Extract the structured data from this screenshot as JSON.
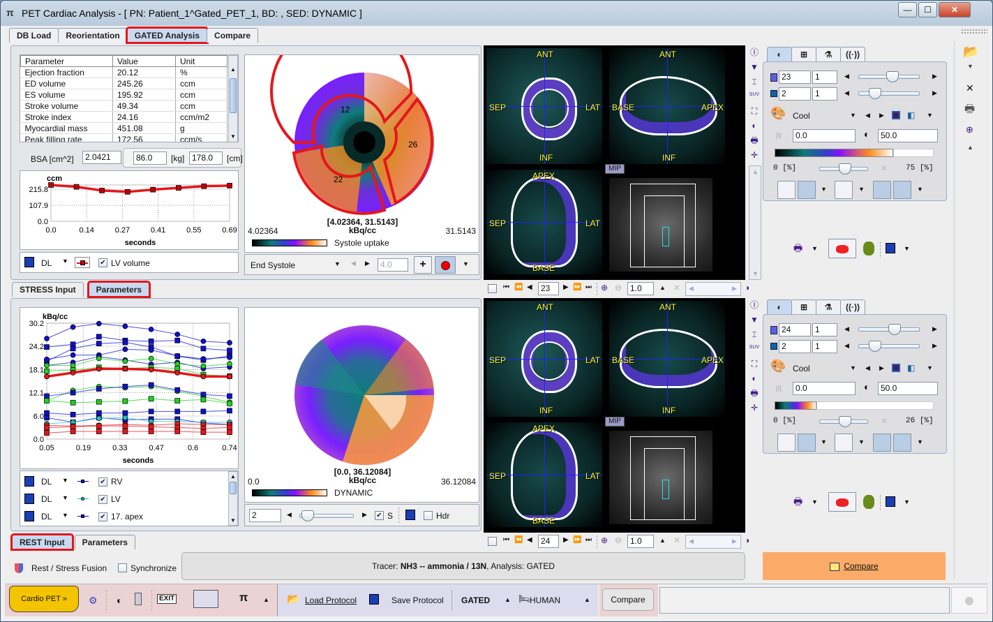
{
  "window": {
    "title": "PET Cardiac Analysis - [ PN: Patient_1^Gated_PET_1, BD: , SED: DYNAMIC ]",
    "app_icon": "pi-icon",
    "buttons": {
      "minimize": "—",
      "maximize": "☐",
      "close": "✕"
    }
  },
  "main_tabs": [
    {
      "label": "DB Load",
      "active": false
    },
    {
      "label": "Reorientation",
      "active": false
    },
    {
      "label": "GATED Analysis",
      "active": true
    },
    {
      "label": "Compare",
      "active": false
    }
  ],
  "stress": {
    "params_table": {
      "headers": [
        "Parameter",
        "Value",
        "Unit"
      ],
      "rows": [
        [
          "Ejection fraction",
          "20.12",
          "%"
        ],
        [
          "ED volume",
          "245.26",
          "ccm"
        ],
        [
          "ES volume",
          "195.92",
          "ccm"
        ],
        [
          "Stroke volume",
          "49.34",
          "ccm"
        ],
        [
          "Stroke index",
          "24.16",
          "ccm/m2"
        ],
        [
          "Myocardial mass",
          "451.08",
          "g"
        ],
        [
          "Peak filling rate",
          "172.56",
          "ccm/s"
        ]
      ]
    },
    "bsa": {
      "label": "BSA [cm^2]",
      "value": "2.0421",
      "weight": "86.0",
      "weight_unit": "[kg]",
      "height": "178.0",
      "height_unit": "[cm]"
    },
    "curve_legend": {
      "save_icon": "save-icon",
      "dl": "DL",
      "series_label": "LV volume",
      "checked": true
    },
    "polar": {
      "range_label": "[4.02364, 31.5143]",
      "unit": "kBq/cc",
      "min": "4.02364",
      "max": "31.5143",
      "colorbar_label": "Systole uptake",
      "segments": [
        "12",
        "26",
        "22"
      ],
      "phase": "End Systole",
      "value_field": "4.0"
    },
    "subtabs": [
      {
        "label": "STRESS Input",
        "active": false
      },
      {
        "label": "Parameters",
        "active": true
      }
    ],
    "viewer": {
      "slice": "23",
      "zoom": "1.0",
      "labels": {
        "ant": "ANT",
        "inf": "INF",
        "sep": "SEP",
        "lat": "LAT",
        "base": "BASE",
        "apex": "APEX",
        "mip": "MIP"
      }
    },
    "control": {
      "frame": "23",
      "frame_step": "1",
      "gate": "2",
      "gate_step": "1",
      "colormap": "Cool",
      "min_value": "0.0",
      "max_value": "50.0",
      "pct_min": "0",
      "pct_max": "75",
      "pct_unit": "[%]",
      "frame_slider": 0.55,
      "gate_slider": 0.2,
      "pct_slider": 0.45
    }
  },
  "rest": {
    "curve_legend": [
      {
        "dl": "DL",
        "label": "RV",
        "checked": true,
        "color": "#1010d0"
      },
      {
        "dl": "DL",
        "label": "LV",
        "checked": true,
        "color": "#20c0c0"
      },
      {
        "dl": "DL",
        "label": "17. apex",
        "checked": true,
        "color": "#1010d0"
      }
    ],
    "polar": {
      "range_label": "[0.0, 36.12084]",
      "unit": "kBq/cc",
      "min": "0.0",
      "max": "36.12084",
      "colorbar_label": "DYNAMIC",
      "frame_field": "2",
      "s_label": "S",
      "hdr_label": "Hdr",
      "s_checked": true,
      "hdr_checked": false
    },
    "subtabs": [
      {
        "label": "REST Input",
        "active": true
      },
      {
        "label": "Parameters",
        "active": false
      }
    ],
    "viewer": {
      "slice": "24",
      "zoom": "1.0",
      "labels": {
        "ant": "ANT",
        "inf": "INF",
        "sep": "SEP",
        "lat": "LAT",
        "base": "BASE",
        "apex": "APEX",
        "mip": "MIP"
      }
    },
    "control": {
      "frame": "24",
      "frame_step": "1",
      "gate": "2",
      "gate_step": "1",
      "colormap": "Cool",
      "min_value": "0.0",
      "max_value": "50.0",
      "pct_min": "0",
      "pct_max": "26",
      "pct_unit": "[%]",
      "frame_slider": 0.6,
      "gate_slider": 0.2,
      "pct_slider": 0.45
    }
  },
  "footer": {
    "fusion_label": "Rest / Stress Fusion",
    "synchronize_label": "Synchronize",
    "synchronize_checked": false,
    "tracer_prefix": "Tracer:",
    "tracer": "NH3 -- ammonia / 13N",
    "analysis": ", Analysis: GATED",
    "compare_button": "Compare"
  },
  "taskbar": {
    "cardio_button": "Cardio PET »",
    "load_protocol": "Load Protocol",
    "save_protocol": "Save Protocol",
    "mode": "GATED",
    "species": "HUMAN",
    "compare": "Compare"
  },
  "colors": {
    "accent_red": "#e5161c",
    "compare_orange": "#fcab68",
    "cardio_yellow": "#f5c400",
    "tab_active": "#c9daf0"
  },
  "chart_data": [
    {
      "type": "line",
      "title": "",
      "ylabel": "ccm",
      "xlabel": "seconds",
      "x_ticks": [
        "0.0",
        "0.14",
        "0.27",
        "0.41",
        "0.55",
        "0.69"
      ],
      "y_ticks": [
        "0.0",
        "107.9",
        "215.8"
      ],
      "xlim": [
        0.0,
        0.69
      ],
      "ylim": [
        0.0,
        245.26
      ],
      "grid": true,
      "series": [
        {
          "name": "LV volume",
          "color": "#e5161c",
          "x": [
            0.0,
            0.0986,
            0.197,
            0.296,
            0.394,
            0.493,
            0.591,
            0.69
          ],
          "y": [
            245.3,
            233.0,
            208.0,
            199.0,
            214.0,
            226.0,
            237.0,
            241.0
          ]
        }
      ]
    },
    {
      "type": "line",
      "ylabel": "kBq/cc",
      "xlabel": "seconds",
      "x_ticks": [
        "0.05",
        "0.19",
        "0.33",
        "0.47",
        "0.6",
        "0.74"
      ],
      "y_ticks": [
        "0.0",
        "6.0",
        "12.1",
        "18.1",
        "24.2",
        "30.2"
      ],
      "xlim": [
        0.05,
        0.74
      ],
      "ylim": [
        0.0,
        30.2
      ],
      "grid": true,
      "x": [
        0.05,
        0.149,
        0.247,
        0.346,
        0.444,
        0.543,
        0.641,
        0.74
      ],
      "series": [
        {
          "name": "blue-circle-1",
          "color": "#1010d0",
          "marker": "circle",
          "y": [
            26.2,
            29.2,
            30.1,
            29.4,
            28.6,
            27.3,
            25.5,
            25.1
          ]
        },
        {
          "name": "blue-square-1",
          "color": "#1010d0",
          "marker": "square",
          "y": [
            24.0,
            24.7,
            26.7,
            25.7,
            25.5,
            25.7,
            23.6,
            23.1
          ]
        },
        {
          "name": "blue-square-2",
          "color": "#1010d0",
          "marker": "square",
          "y": [
            20.3,
            23.6,
            24.9,
            25.2,
            24.0,
            21.6,
            20.6,
            21.7
          ]
        },
        {
          "name": "blue-circle-2",
          "color": "#1010d0",
          "marker": "circle",
          "y": [
            20.8,
            21.9,
            21.9,
            23.4,
            23.2,
            21.7,
            20.9,
            21.3
          ]
        },
        {
          "name": "blue-circle-3",
          "color": "#1010d0",
          "marker": "circle",
          "y": [
            19.2,
            20.0,
            21.5,
            20.6,
            19.5,
            20.0,
            18.4,
            18.8
          ]
        },
        {
          "name": "green-circle-1",
          "color": "#20d020",
          "marker": "circle",
          "y": [
            19.2,
            19.2,
            21.0,
            20.3,
            21.0,
            19.6,
            19.0,
            19.6
          ]
        },
        {
          "name": "green-square-1",
          "color": "#20d020",
          "marker": "square",
          "y": [
            17.7,
            18.0,
            18.7,
            18.4,
            18.7,
            18.4,
            16.8,
            16.4
          ]
        },
        {
          "name": "red-thick",
          "color": "#e5161c",
          "marker": "circle",
          "y": [
            16.3,
            17.3,
            18.3,
            18.3,
            18.1,
            17.3,
            16.3,
            16.3
          ]
        },
        {
          "name": "green-circle-2",
          "color": "#20d020",
          "marker": "circle",
          "y": [
            10.0,
            12.7,
            13.7,
            13.4,
            13.7,
            12.5,
            11.1,
            9.6
          ]
        },
        {
          "name": "blue-square-3",
          "color": "#1010d0",
          "marker": "square",
          "y": [
            11.2,
            12.1,
            13.1,
            13.7,
            14.1,
            12.8,
            11.6,
            11.2
          ]
        },
        {
          "name": "green-square-2",
          "color": "#20d020",
          "marker": "square",
          "y": [
            10.0,
            9.5,
            9.7,
            9.9,
            10.5,
            10.0,
            10.3,
            9.3
          ]
        },
        {
          "name": "blue-square-4",
          "color": "#1010d0",
          "marker": "square",
          "y": [
            6.8,
            6.4,
            6.8,
            6.8,
            7.2,
            7.2,
            7.2,
            7.4
          ]
        },
        {
          "name": "blue-square-5",
          "color": "#1010d0",
          "marker": "square",
          "y": [
            5.6,
            4.4,
            5.6,
            5.0,
            5.2,
            5.2,
            4.2,
            3.8
          ]
        },
        {
          "name": "LV",
          "color": "#20c0c0",
          "marker": "circle",
          "y": [
            4.0,
            4.4,
            5.4,
            5.6,
            4.6,
            4.6,
            4.4,
            4.4
          ]
        },
        {
          "name": "red-1",
          "color": "#e5161c",
          "marker": "circle",
          "y": [
            3.6,
            3.4,
            3.6,
            3.8,
            3.6,
            4.0,
            3.8,
            3.8
          ]
        },
        {
          "name": "red-2",
          "color": "#e5161c",
          "marker": "square",
          "y": [
            3.0,
            3.2,
            3.4,
            3.4,
            3.2,
            3.0,
            2.8,
            3.0
          ]
        },
        {
          "name": "red-3",
          "color": "#e5161c",
          "marker": "square",
          "y": [
            1.6,
            2.0,
            2.0,
            2.0,
            2.0,
            2.0,
            1.8,
            1.8
          ]
        }
      ]
    }
  ]
}
